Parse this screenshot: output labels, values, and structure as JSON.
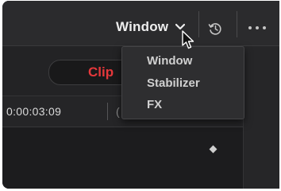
{
  "toolbar": {
    "window_menu_label": "Window",
    "chevron_icon": "chevron-down-icon",
    "history_icon": "history-icon",
    "more_icon": "more-horizontal-icon"
  },
  "subbar": {
    "clip_label": "Clip"
  },
  "timeline": {
    "timecode": "0:00:03:09",
    "secondary_timecode": "("
  },
  "dropdown": {
    "items": [
      "Window",
      "Stabilizer",
      "FX"
    ]
  },
  "colors": {
    "clip_accent": "#e5383b",
    "background": "#1f1f21"
  }
}
